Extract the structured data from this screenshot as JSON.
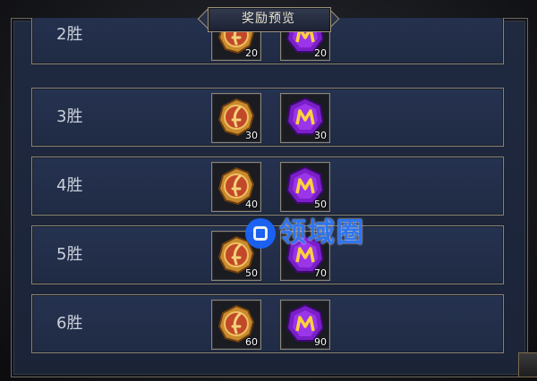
{
  "title": "奖励预览",
  "colors": {
    "panel": "#1f2940",
    "border": "#8a8372",
    "accent": "#2f7bff"
  },
  "rows": [
    {
      "label": "2胜",
      "rewards": [
        {
          "icon": "gold-medal-icon",
          "qty": "20"
        },
        {
          "icon": "purple-gem-icon",
          "qty": "20"
        }
      ]
    },
    {
      "label": "3胜",
      "rewards": [
        {
          "icon": "gold-medal-icon",
          "qty": "30"
        },
        {
          "icon": "purple-gem-icon",
          "qty": "30"
        }
      ]
    },
    {
      "label": "4胜",
      "rewards": [
        {
          "icon": "gold-medal-icon",
          "qty": "40"
        },
        {
          "icon": "purple-gem-icon",
          "qty": "50"
        }
      ]
    },
    {
      "label": "5胜",
      "rewards": [
        {
          "icon": "gold-medal-icon",
          "qty": "50"
        },
        {
          "icon": "purple-gem-icon",
          "qty": "70"
        }
      ]
    },
    {
      "label": "6胜",
      "rewards": [
        {
          "icon": "gold-medal-icon",
          "qty": "60"
        },
        {
          "icon": "purple-gem-icon",
          "qty": "90"
        }
      ]
    }
  ],
  "watermark": {
    "text": "领域圈"
  }
}
